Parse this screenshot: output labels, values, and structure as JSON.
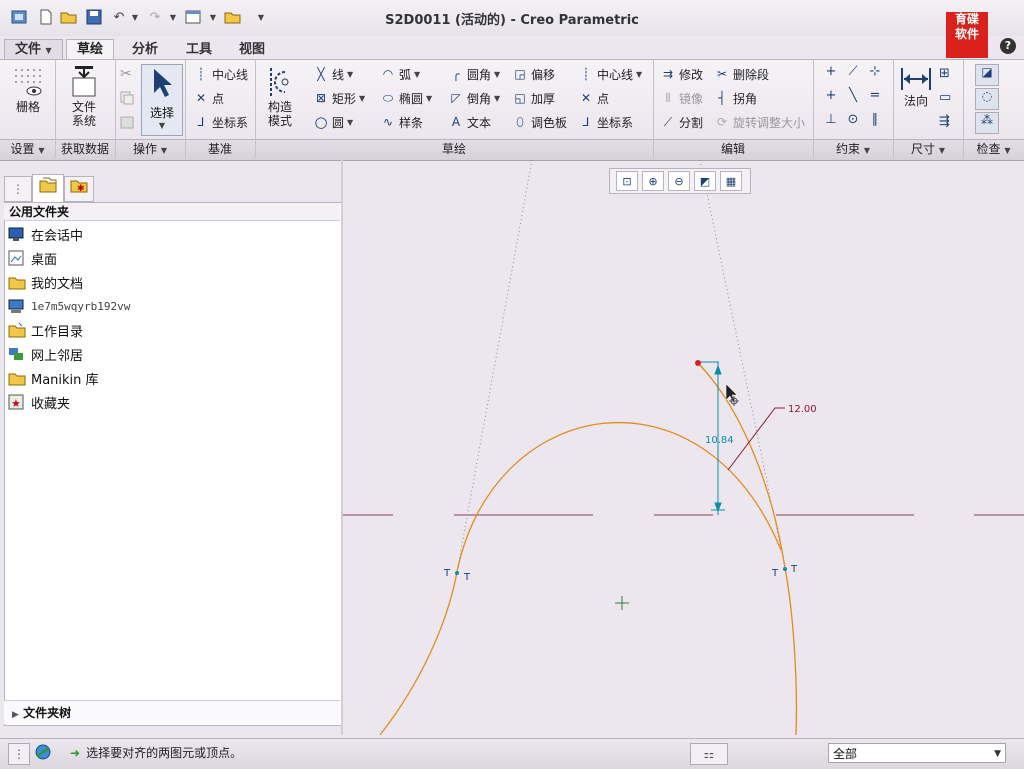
{
  "window": {
    "title": "S2D0011 (活动的) - Creo Parametric"
  },
  "quick_access": [
    "new-icon",
    "open-icon",
    "save-icon",
    "undo-icon",
    "redo-icon",
    "windows-icon",
    "folder-icon",
    "customize-icon"
  ],
  "tabs": [
    {
      "label": "文件",
      "key": "file"
    },
    {
      "label": "草绘",
      "key": "sketch"
    },
    {
      "label": "分析",
      "key": "analysis"
    },
    {
      "label": "工具",
      "key": "tools"
    },
    {
      "label": "视图",
      "key": "view"
    }
  ],
  "ribbon": {
    "grid": "栅格",
    "file_system": [
      "文件",
      "系统"
    ],
    "select": "选择",
    "datum": {
      "centerline": "中心线",
      "point": "点",
      "csys": "坐标系"
    },
    "construction": [
      "构造",
      "模式"
    ],
    "sketch": {
      "line": "线",
      "rectangle": "矩形",
      "circle": "圆",
      "arc": "弧",
      "ellipse": "椭圆",
      "spline": "样条",
      "fillet": "圆角",
      "chamfer": "倒角",
      "text": "文本",
      "offset": "偏移",
      "thicken": "加厚",
      "palette": "调色板",
      "centerline": "中心线",
      "point": "点",
      "csys": "坐标系"
    },
    "edit": {
      "modify": "修改",
      "delete_segment": "删除段",
      "mirror": "镜像",
      "corner": "拐角",
      "divide": "分割",
      "rotate_resize": "旋转调整大小"
    },
    "normal": "法向",
    "groups": {
      "setup": "设置",
      "get_data": "获取数据",
      "operations": "操作",
      "datum": "基准",
      "sketching": "草绘",
      "editing": "编辑",
      "constrain": "约束",
      "dimension": "尺寸",
      "inspect": "检查"
    }
  },
  "logo": {
    "line1": "育碟",
    "line2": "软件"
  },
  "folders": {
    "header": "公用文件夹",
    "items": [
      {
        "label": "在会话中",
        "icon": "monitor-icon"
      },
      {
        "label": "桌面",
        "icon": "desktop-icon"
      },
      {
        "label": "我的文档",
        "icon": "documents-icon"
      },
      {
        "label": "1e7m5wqyrb192vw",
        "icon": "computer-icon"
      },
      {
        "label": "工作目录",
        "icon": "working-folder-icon"
      },
      {
        "label": "网上邻居",
        "icon": "network-icon"
      },
      {
        "label": "Manikin 库",
        "icon": "library-icon"
      },
      {
        "label": "收藏夹",
        "icon": "favorites-icon"
      }
    ],
    "footer": "文件夹树"
  },
  "graphics": {
    "dim_vertical": "10.84",
    "dim_radius": "12.00",
    "tangent_marks": [
      "T",
      "T",
      "T",
      "T"
    ],
    "colors": {
      "curve": "#e58a1c",
      "centerline": "#8a3a55",
      "dimension": "#0e8ca8",
      "radius_dim": "#8b1a2c",
      "construction": "#8a8a8a",
      "point": "#e02020"
    }
  },
  "status": {
    "message": "选择要对齐的两图元或顶点。",
    "filter": "全部"
  }
}
